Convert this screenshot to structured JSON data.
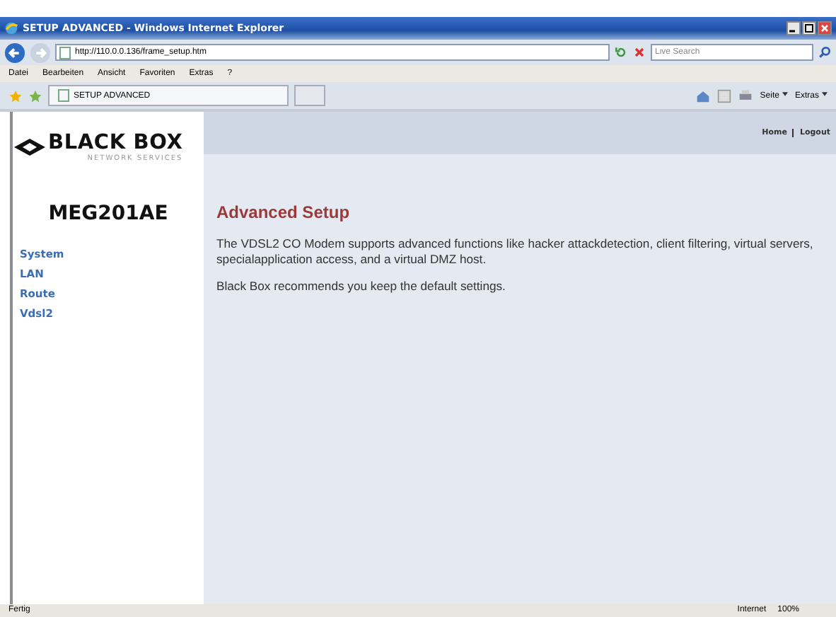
{
  "window": {
    "title": "SETUP ADVANCED - Windows Internet Explorer"
  },
  "address_bar": {
    "url": "http://110.0.0.136/frame_setup.htm"
  },
  "search": {
    "placeholder": "Live Search"
  },
  "menu": [
    "Datei",
    "Bearbeiten",
    "Ansicht",
    "Favoriten",
    "Extras",
    "?"
  ],
  "tab": {
    "title": "SETUP ADVANCED"
  },
  "command_bar": [
    "Seite",
    "Extras"
  ],
  "logo": {
    "name": "BLACK BOX",
    "tagline": "NETWORK SERVICES"
  },
  "header_links": [
    "Home",
    "Logout"
  ],
  "device": "MEG201AE",
  "sidebar": {
    "items": [
      "System",
      "LAN",
      "Route",
      "Vdsl2"
    ]
  },
  "content": {
    "title": "Advanced Setup",
    "paragraphs": [
      "The VDSL2 CO Modem supports advanced functions like hacker attackdetection, client filtering, virtual servers, specialapplication access, and a virtual DMZ host.",
      "Black Box recommends you keep the default settings."
    ]
  },
  "status_bar": {
    "status": "Fertig",
    "zone": "Internet",
    "zoom": "100%"
  }
}
